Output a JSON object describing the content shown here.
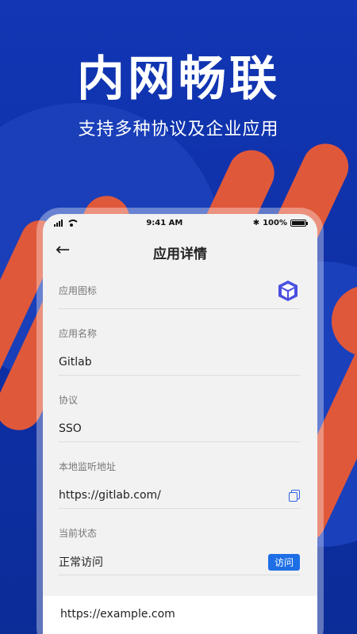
{
  "banner": {
    "headline": "内网畅联",
    "subline": "支持多种协议及企业应用"
  },
  "statusbar": {
    "time": "9:41 AM",
    "battery": "100%",
    "battery_level": 1.0
  },
  "page": {
    "title": "应用详情",
    "back_icon": "back-arrow-icon"
  },
  "fields": {
    "icon_label": "应用图标",
    "name_label": "应用名称",
    "name_value": "Gitlab",
    "protocol_label": "协议",
    "protocol_value": "SSO",
    "listen_label": "本地监听地址",
    "listen_value": "https://gitlab.com/",
    "status_label": "当前状态",
    "status_value": "正常访问",
    "visit_button": "访问"
  },
  "bottom": {
    "url": "https://example.com"
  },
  "colors": {
    "background": "#1033a8",
    "accent_orange": "#e0583a",
    "link_blue": "#1e6fe6"
  }
}
